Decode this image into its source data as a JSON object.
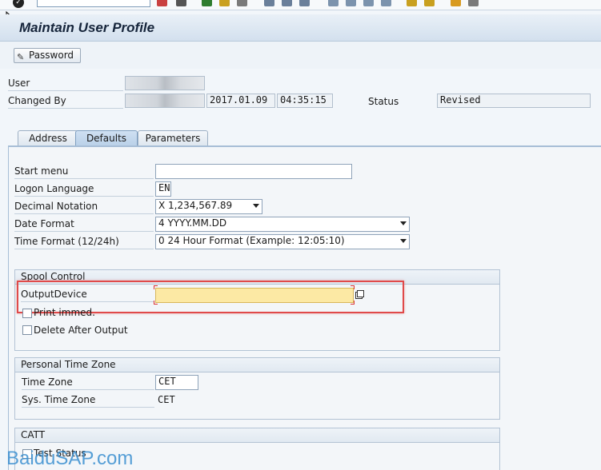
{
  "window": {
    "title": "Maintain User Profile"
  },
  "appbar": {
    "password_label": "Password"
  },
  "header": {
    "user_label": "User",
    "changed_by_label": "Changed By",
    "changed_date": "2017.01.09",
    "changed_time": "04:35:15",
    "status_label": "Status",
    "status_value": "Revised"
  },
  "tabs": [
    {
      "label": "Address"
    },
    {
      "label": "Defaults"
    },
    {
      "label": "Parameters"
    }
  ],
  "defaults": {
    "start_menu_label": "Start menu",
    "start_menu_value": "",
    "logon_language_label": "Logon Language",
    "logon_language_value": "EN",
    "decimal_notation_label": "Decimal Notation",
    "decimal_notation_value": "X 1,234,567.89",
    "date_format_label": "Date Format",
    "date_format_value": "4 YYYY.MM.DD",
    "time_format_label": "Time Format (12/24h)",
    "time_format_value": "0 24 Hour Format (Example: 12:05:10)"
  },
  "spool": {
    "title": "Spool Control",
    "output_device_label": "OutputDevice",
    "output_device_value": "",
    "print_immed_label": "Print immed.",
    "delete_after_label": "Delete After Output"
  },
  "timezone": {
    "title": "Personal Time Zone",
    "time_zone_label": "Time Zone",
    "time_zone_value": "CET",
    "sys_time_zone_label": "Sys. Time Zone",
    "sys_time_zone_value": "CET"
  },
  "catt": {
    "title": "CATT",
    "test_status_label": "Test Status"
  },
  "watermark": {
    "text": "BaiduSAP.com"
  },
  "colors": {
    "highlight": "#e04a4a",
    "required_field": "#fce9a4",
    "title_text": "#15243a"
  }
}
